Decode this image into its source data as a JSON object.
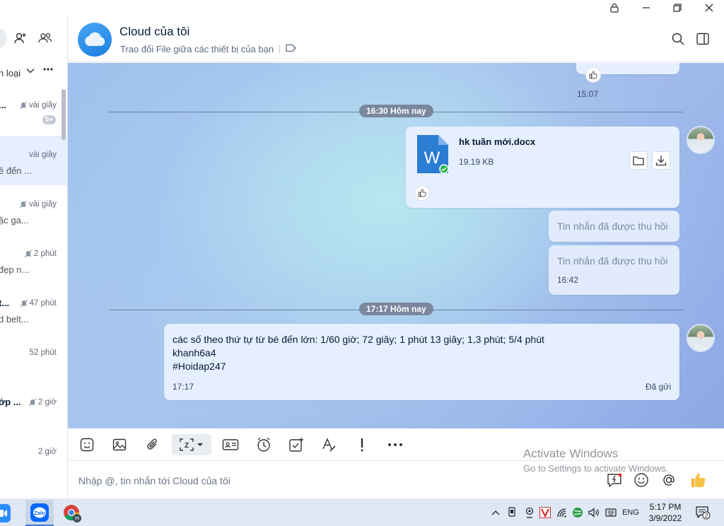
{
  "window": {
    "controls": [
      "lock-icon",
      "minimize-icon",
      "restore-icon",
      "close-icon"
    ]
  },
  "sidebar": {
    "filter_label": "n loại",
    "conversations": [
      {
        "snippet": "...",
        "time": "vài giây",
        "muted": true,
        "badge": "5+",
        "sub": ""
      },
      {
        "snippet": "",
        "time": "vài giây",
        "muted": false,
        "badge": "",
        "sub": "ê đến ..."
      },
      {
        "snippet": "",
        "time": "vài giây",
        "muted": true,
        "badge": "",
        "sub": "ặc ga..."
      },
      {
        "snippet": "",
        "time": "2 phút",
        "muted": true,
        "badge": "",
        "sub": "đẹp n..."
      },
      {
        "snippet": "t...",
        "time": "47 phút",
        "muted": true,
        "badge": "",
        "sub": "d belt..."
      },
      {
        "snippet": "",
        "time": "52 phút",
        "muted": false,
        "badge": "",
        "sub": ""
      },
      {
        "snippet": "ớp ...",
        "time": "2 giờ",
        "muted": true,
        "badge": "",
        "sub": ""
      },
      {
        "snippet": "",
        "time": "2 giờ",
        "muted": false,
        "badge": "",
        "sub": ""
      }
    ]
  },
  "header": {
    "title": "Cloud của tôi",
    "subtitle": "Trao đổi File giữa các thiết bị của bạn"
  },
  "messages": {
    "old_time": "15:07",
    "divider1": "16:30 Hôm nay",
    "file": {
      "name": "hk tuần mới.docx",
      "size": "19.19 KB",
      "icon_letter": "W"
    },
    "recalled1": "Tin nhắn đã được thu hồi",
    "recalled2": "Tin nhắn đã được thu hồi",
    "recalled2_time": "16:42",
    "divider2": "17:17 Hôm nay",
    "text": {
      "line1": "các số theo thứ tự từ bé đến lớn: 1/60 giờ; 72 giây; 1 phút 13 giây; 1,3 phút; 5/4 phút",
      "line2": "khanh6a4",
      "line3": "#Hoidap247",
      "time": "17:17",
      "status": "Đã gửi"
    }
  },
  "composer": {
    "placeholder": "Nhập @, tin nhắn tới Cloud của tôi"
  },
  "watermark": {
    "line1": "Activate Windows",
    "line2": "Go to Settings to activate Windows."
  },
  "taskbar": {
    "zalo_label": "Zalo",
    "lang": "ENG",
    "time": "5:17 PM",
    "date": "3/9/2022",
    "notif_count": "2"
  },
  "colors": {
    "accent": "#0068ff",
    "bubble": "#e5efff",
    "word_blue": "#2b7cd3"
  }
}
